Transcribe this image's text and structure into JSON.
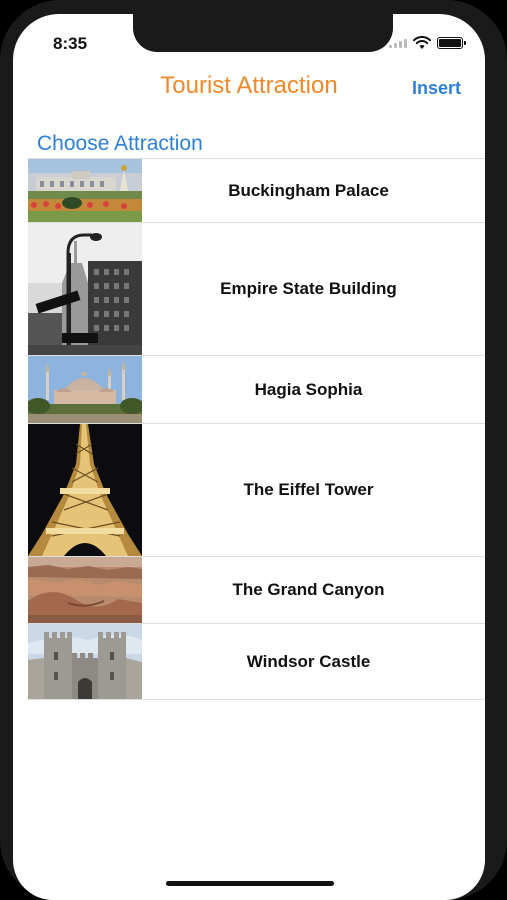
{
  "status": {
    "time": "8:35"
  },
  "nav": {
    "title": "Tourist Attraction",
    "insert_label": "Insert"
  },
  "section": {
    "header": "Choose Attraction"
  },
  "attractions": [
    {
      "label": "Buckingham Palace"
    },
    {
      "label": "Empire State Building"
    },
    {
      "label": "Hagia Sophia"
    },
    {
      "label": "The Eiffel Tower"
    },
    {
      "label": "The Grand Canyon"
    },
    {
      "label": "Windsor Castle"
    }
  ],
  "colors": {
    "title": "#f0892b",
    "accent": "#2f7fd8"
  }
}
